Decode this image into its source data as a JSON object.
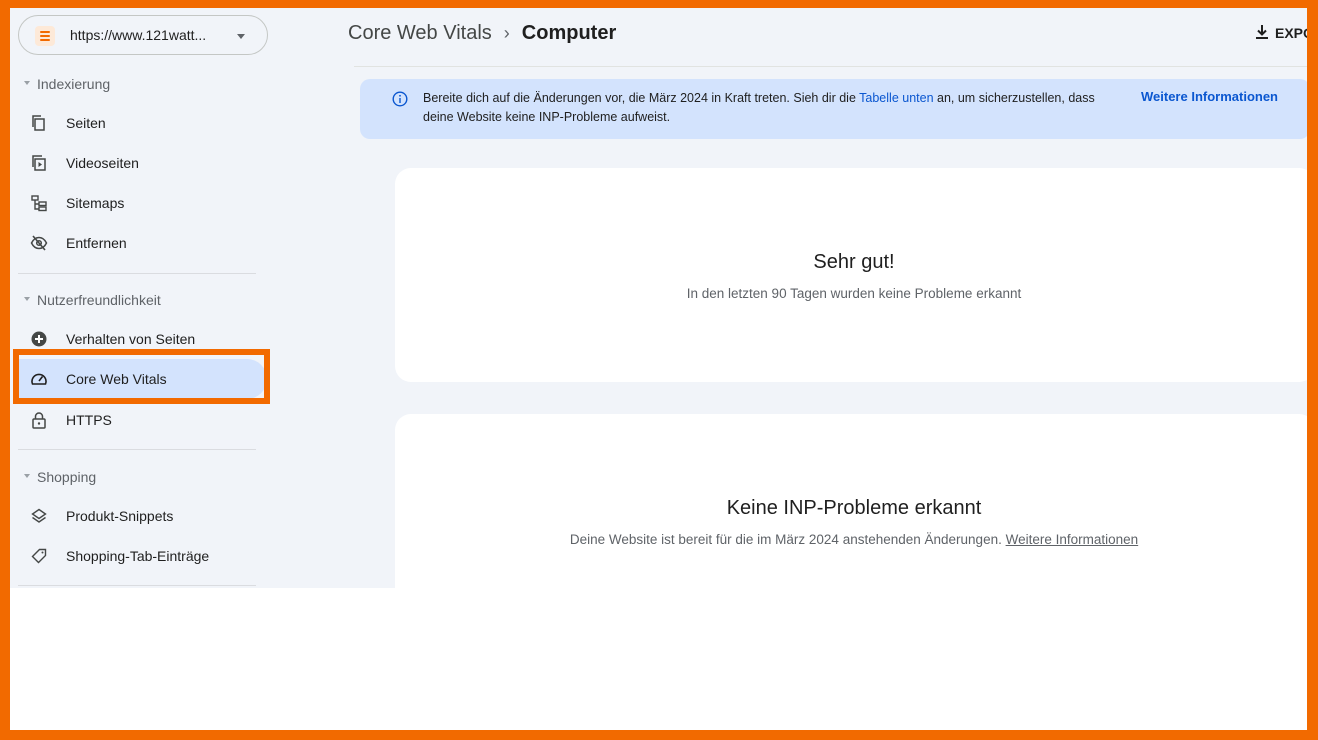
{
  "property": {
    "url": "https://www.121watt...",
    "icon": "search-console-logo"
  },
  "sidebar": {
    "sections": [
      {
        "title": "Indexierung",
        "items": [
          {
            "label": "Seiten",
            "icon": "pages-icon"
          },
          {
            "label": "Videoseiten",
            "icon": "video-pages-icon"
          },
          {
            "label": "Sitemaps",
            "icon": "sitemap-icon"
          },
          {
            "label": "Entfernen",
            "icon": "eye-off-icon"
          }
        ]
      },
      {
        "title": "Nutzerfreundlichkeit",
        "items": [
          {
            "label": "Verhalten von Seiten",
            "icon": "plus-circle-icon"
          },
          {
            "label": "Core Web Vitals",
            "icon": "speedometer-icon",
            "active": true
          },
          {
            "label": "HTTPS",
            "icon": "lock-icon"
          }
        ]
      },
      {
        "title": "Shopping",
        "items": [
          {
            "label": "Produkt-Snippets",
            "icon": "layers-icon"
          },
          {
            "label": "Shopping-Tab-Einträge",
            "icon": "tag-icon"
          }
        ]
      }
    ]
  },
  "header": {
    "breadcrumb_parent": "Core Web Vitals",
    "breadcrumb_sep": "›",
    "breadcrumb_current": "Computer",
    "export_label": "EXPO"
  },
  "banner": {
    "text_before": "Bereite dich auf die Änderungen vor, die März 2024 in Kraft treten. Sieh dir die ",
    "link_text": "Tabelle unten",
    "text_after": " an, um sicherzustellen, dass deine Website keine INP-Probleme aufweist.",
    "more_label": "Weitere Informationen"
  },
  "card1": {
    "title": "Sehr gut!",
    "subtitle": "In den letzten 90 Tagen wurden keine Probleme erkannt"
  },
  "card2": {
    "title": "Keine INP-Probleme erkannt",
    "subtitle": "Deine Website ist bereit für die im März 2024 anstehenden Änderungen. ",
    "link_text": "Weitere Informationen"
  },
  "colors": {
    "highlight": "#f26a00",
    "active_nav": "#d3e3fd",
    "link": "#0b57d0",
    "background": "#f1f4f9"
  }
}
